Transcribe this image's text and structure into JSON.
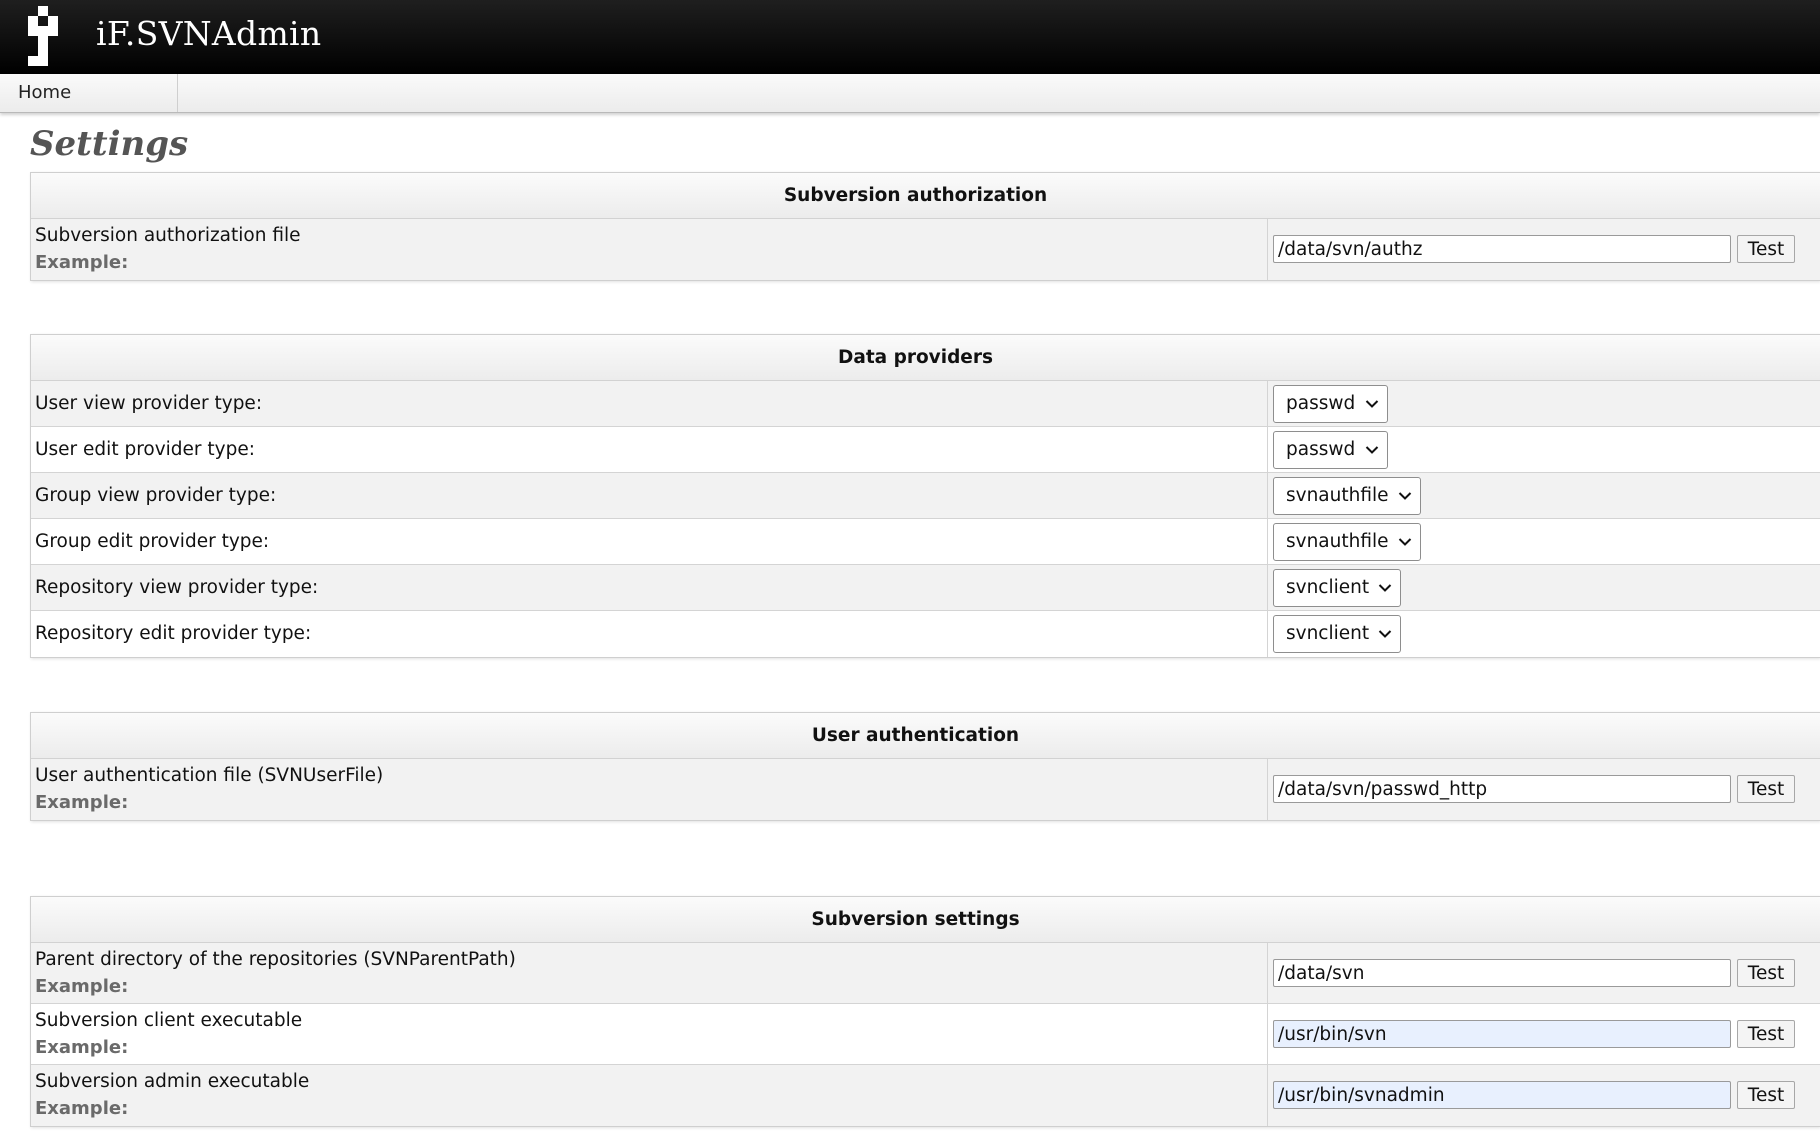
{
  "app": {
    "title": "iF.SVNAdmin"
  },
  "nav": {
    "items": [
      {
        "label": "Home"
      }
    ]
  },
  "page": {
    "title": "Settings"
  },
  "icons": {
    "logo": "svnadmin-logo-icon",
    "select_arrow": "chevron-down-icon"
  },
  "colors": {
    "header_bg": "#000000",
    "autofill_bg": "#e8f0fe",
    "example_text": "#6a6a6a"
  },
  "sections": {
    "svn_auth": {
      "title": "Subversion authorization",
      "rows": [
        {
          "label": "Subversion authorization file",
          "example": "Example:",
          "value": "/data/svn/authz",
          "button": "Test"
        }
      ]
    },
    "providers": {
      "title": "Data providers",
      "rows": [
        {
          "label": "User view provider type:",
          "selected": "passwd"
        },
        {
          "label": "User edit provider type:",
          "selected": "passwd"
        },
        {
          "label": "Group view provider type:",
          "selected": "svnauthfile"
        },
        {
          "label": "Group edit provider type:",
          "selected": "svnauthfile"
        },
        {
          "label": "Repository view provider type:",
          "selected": "svnclient"
        },
        {
          "label": "Repository edit provider type:",
          "selected": "svnclient"
        }
      ]
    },
    "user_auth": {
      "title": "User authentication",
      "rows": [
        {
          "label": "User authentication file (SVNUserFile)",
          "example": "Example:",
          "value": "/data/svn/passwd_http",
          "button": "Test"
        }
      ]
    },
    "svn_settings": {
      "title": "Subversion settings",
      "rows": [
        {
          "label": "Parent directory of the repositories (SVNParentPath)",
          "example": "Example:",
          "value": "/data/svn",
          "button": "Test"
        },
        {
          "label": "Subversion client executable",
          "example": "Example:",
          "value": "/usr/bin/svn",
          "button": "Test"
        },
        {
          "label": "Subversion admin executable",
          "example": "Example:",
          "value": "/usr/bin/svnadmin",
          "button": "Test"
        }
      ]
    }
  }
}
